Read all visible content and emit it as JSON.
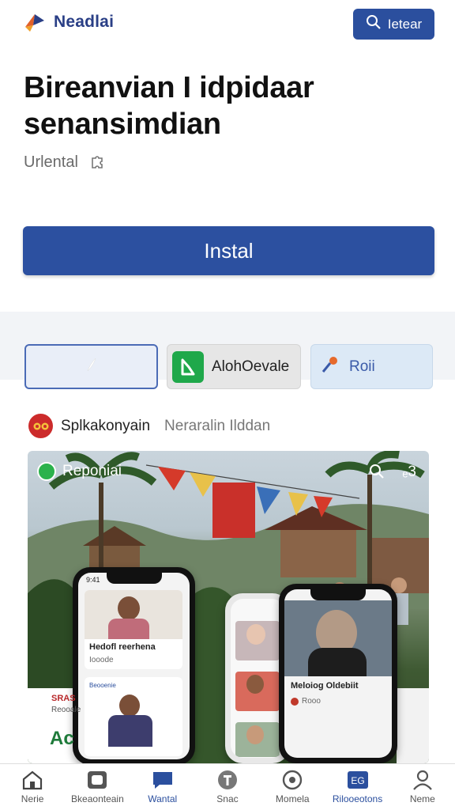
{
  "header": {
    "brand_name": "Neadlai",
    "search_label": "Ietear"
  },
  "app": {
    "title": "Bireanvian I idpidaar senansimdian",
    "subtitle": "Urlental",
    "install_label": "Instal"
  },
  "chips": [
    {
      "label": ""
    },
    {
      "label": "AlohOevale"
    },
    {
      "label": "Roii"
    }
  ],
  "source": {
    "name": "Splkakonyain",
    "meta": "Nerаralin Ilddan"
  },
  "hero": {
    "overlay_title": "Reponiai",
    "tool_text": "ₑ3",
    "phone_left": {
      "status": "9:41",
      "card_name": "Hedofl reerhena",
      "card_sub": "Iooode",
      "promo": "SRAS",
      "promo_sub": "Reooale",
      "promo_big": "Ac",
      "mini_label": "Beooenie"
    },
    "phone_right": {
      "card_name": "Meloiog Oldebiit",
      "card_sub": "Rooo"
    }
  },
  "nav": [
    {
      "label": "Nerie",
      "icon": "home-icon"
    },
    {
      "label": "Bkeaonteain",
      "icon": "camera-icon"
    },
    {
      "label": "Wantal",
      "icon": "chat-icon"
    },
    {
      "label": "Snac",
      "icon": "info-icon"
    },
    {
      "label": "Momela",
      "icon": "target-icon"
    },
    {
      "label": "Rilooeotons",
      "icon": "grid-icon"
    },
    {
      "label": "Neme",
      "icon": "profile-icon"
    }
  ],
  "colors": {
    "primary": "#2c50a0",
    "chip_green": "#1fa84a",
    "brand_text": "#2a3f86"
  }
}
